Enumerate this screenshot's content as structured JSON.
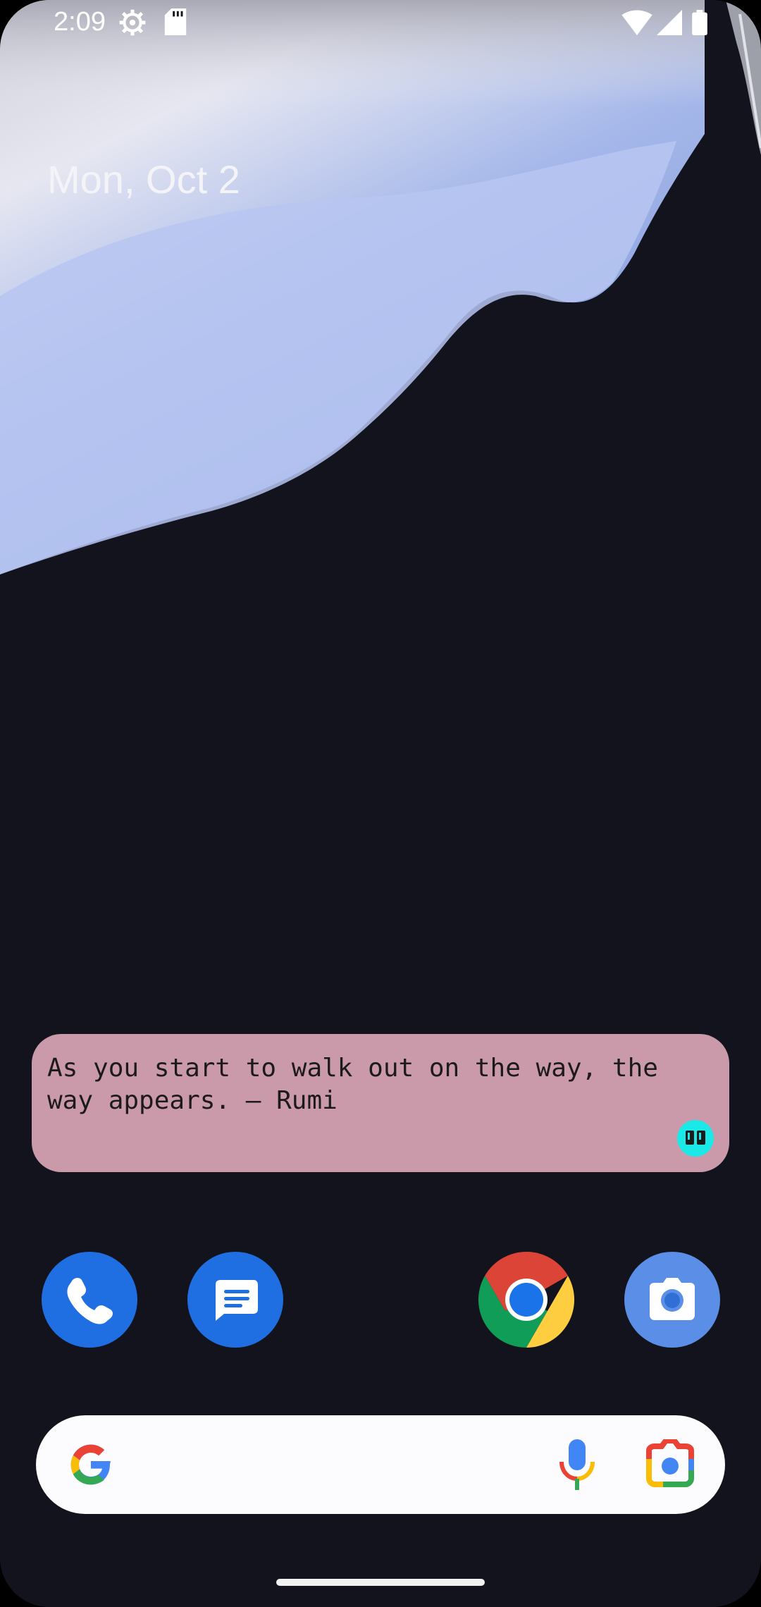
{
  "status_bar": {
    "time": "2:09",
    "icons": [
      "settings-icon",
      "sd-card-icon",
      "wifi-icon",
      "signal-icon",
      "battery-icon"
    ]
  },
  "date": "Mon, Oct 2",
  "quote_widget": {
    "text": "As you start to walk out on the way, the\nway appears. — Rumi",
    "background": "#cb9aaa",
    "badge_icon": "quote-app-icon"
  },
  "dock": {
    "apps": [
      {
        "name": "Phone",
        "icon": "phone-icon",
        "color": "#1f6fe2"
      },
      {
        "name": "Messages",
        "icon": "messages-icon",
        "color": "#1f6fe2"
      },
      {
        "name": "Chrome",
        "icon": "chrome-icon"
      },
      {
        "name": "Camera",
        "icon": "camera-icon",
        "color": "#5b8ee6"
      }
    ]
  },
  "search_bar": {
    "icons": [
      "google-logo-icon",
      "microphone-icon",
      "google-lens-icon"
    ]
  }
}
